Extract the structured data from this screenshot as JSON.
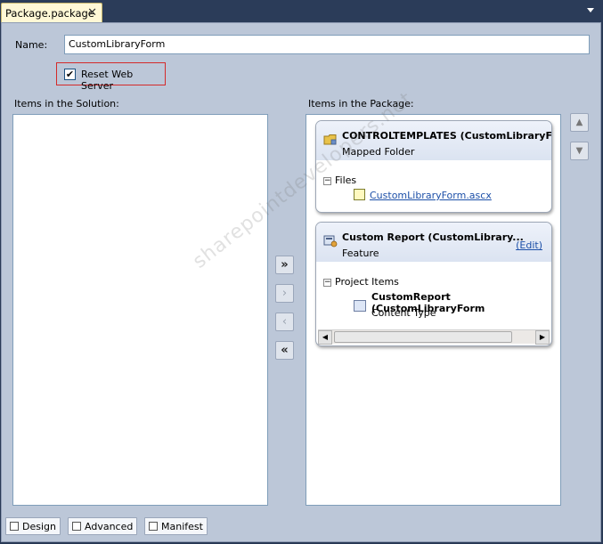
{
  "document_tab": {
    "title": "Package.package",
    "close_glyph": "✕"
  },
  "form": {
    "name_label": "Name:",
    "name_value": "CustomLibraryForm",
    "reset_checkbox_label": "Reset Web Server",
    "reset_checked": true
  },
  "solution_panel": {
    "label": "Items in the Solution:"
  },
  "package_panel": {
    "label": "Items in the Package:",
    "cards": [
      {
        "title": "CONTROLTEMPLATES (CustomLibraryFo...",
        "subtitle": "Mapped Folder",
        "icon": "folder-icon",
        "group_label": "Files",
        "group_toggle": "−",
        "item_label": "CustomLibraryForm.ascx",
        "item_icon": "ascx-file-icon"
      },
      {
        "title": "Custom Report (CustomLibrary...",
        "subtitle": "Feature",
        "edit_label": "(Edit)",
        "icon": "feature-icon",
        "group_label": "Project Items",
        "group_toggle": "−",
        "item_title": "CustomReport (CustomLibraryForm",
        "item_subtitle": "Content Type",
        "item_icon": "content-type-icon"
      }
    ]
  },
  "move_buttons": {
    "add_all": "»",
    "add": "›",
    "remove": "‹",
    "remove_all": "«"
  },
  "order_buttons": {
    "up": "▲",
    "down": "▼"
  },
  "scroll_arrows": {
    "left": "◀",
    "right": "▶"
  },
  "bottom_tabs": [
    {
      "label": "Design",
      "icon": "design-icon"
    },
    {
      "label": "Advanced",
      "icon": "advanced-icon"
    },
    {
      "label": "Manifest",
      "icon": "manifest-icon"
    }
  ],
  "watermark": "sharepointdevelopers.net",
  "colors": {
    "designer_bg": "#bcc7d8",
    "tab_bg": "#fff8d6",
    "highlight_border": "#d42a2a",
    "link": "#1c4fa8"
  }
}
